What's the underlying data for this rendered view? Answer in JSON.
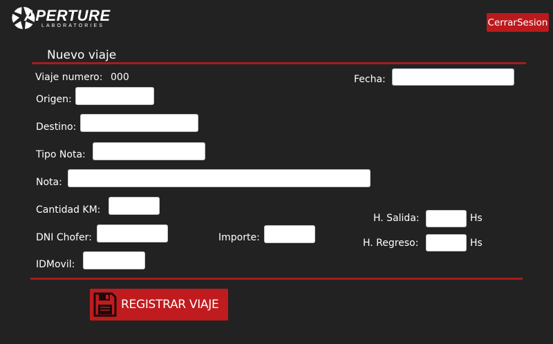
{
  "brand": {
    "name": "APERTURE",
    "subtitle": "LABORATORIES"
  },
  "header": {
    "logout_label": "CerrarSesion"
  },
  "form": {
    "title": "Nuevo viaje",
    "trip_number_label": "Viaje numero:",
    "trip_number_value": "000",
    "date_label": "Fecha:",
    "origin_label": "Origen:",
    "destination_label": "Destino:",
    "note_type_label": "Tipo Nota:",
    "note_label": "Nota:",
    "km_label": "Cantidad KM:",
    "driver_dni_label": "DNI Chofer:",
    "amount_label": "Importe:",
    "vehicle_id_label": "IDMovil:",
    "departure_label": "H. Salida:",
    "return_label": "H. Regreso:",
    "hours_unit": "Hs",
    "submit_label": "REGISTRAR VIAJE"
  },
  "icons": {
    "logo": "aperture-logo-icon",
    "calendar": "calendar-icon",
    "save": "floppy-disk-icon"
  },
  "colors": {
    "background": "#222223",
    "accent": "#bb1a1d",
    "rule": "#a71c1f"
  }
}
